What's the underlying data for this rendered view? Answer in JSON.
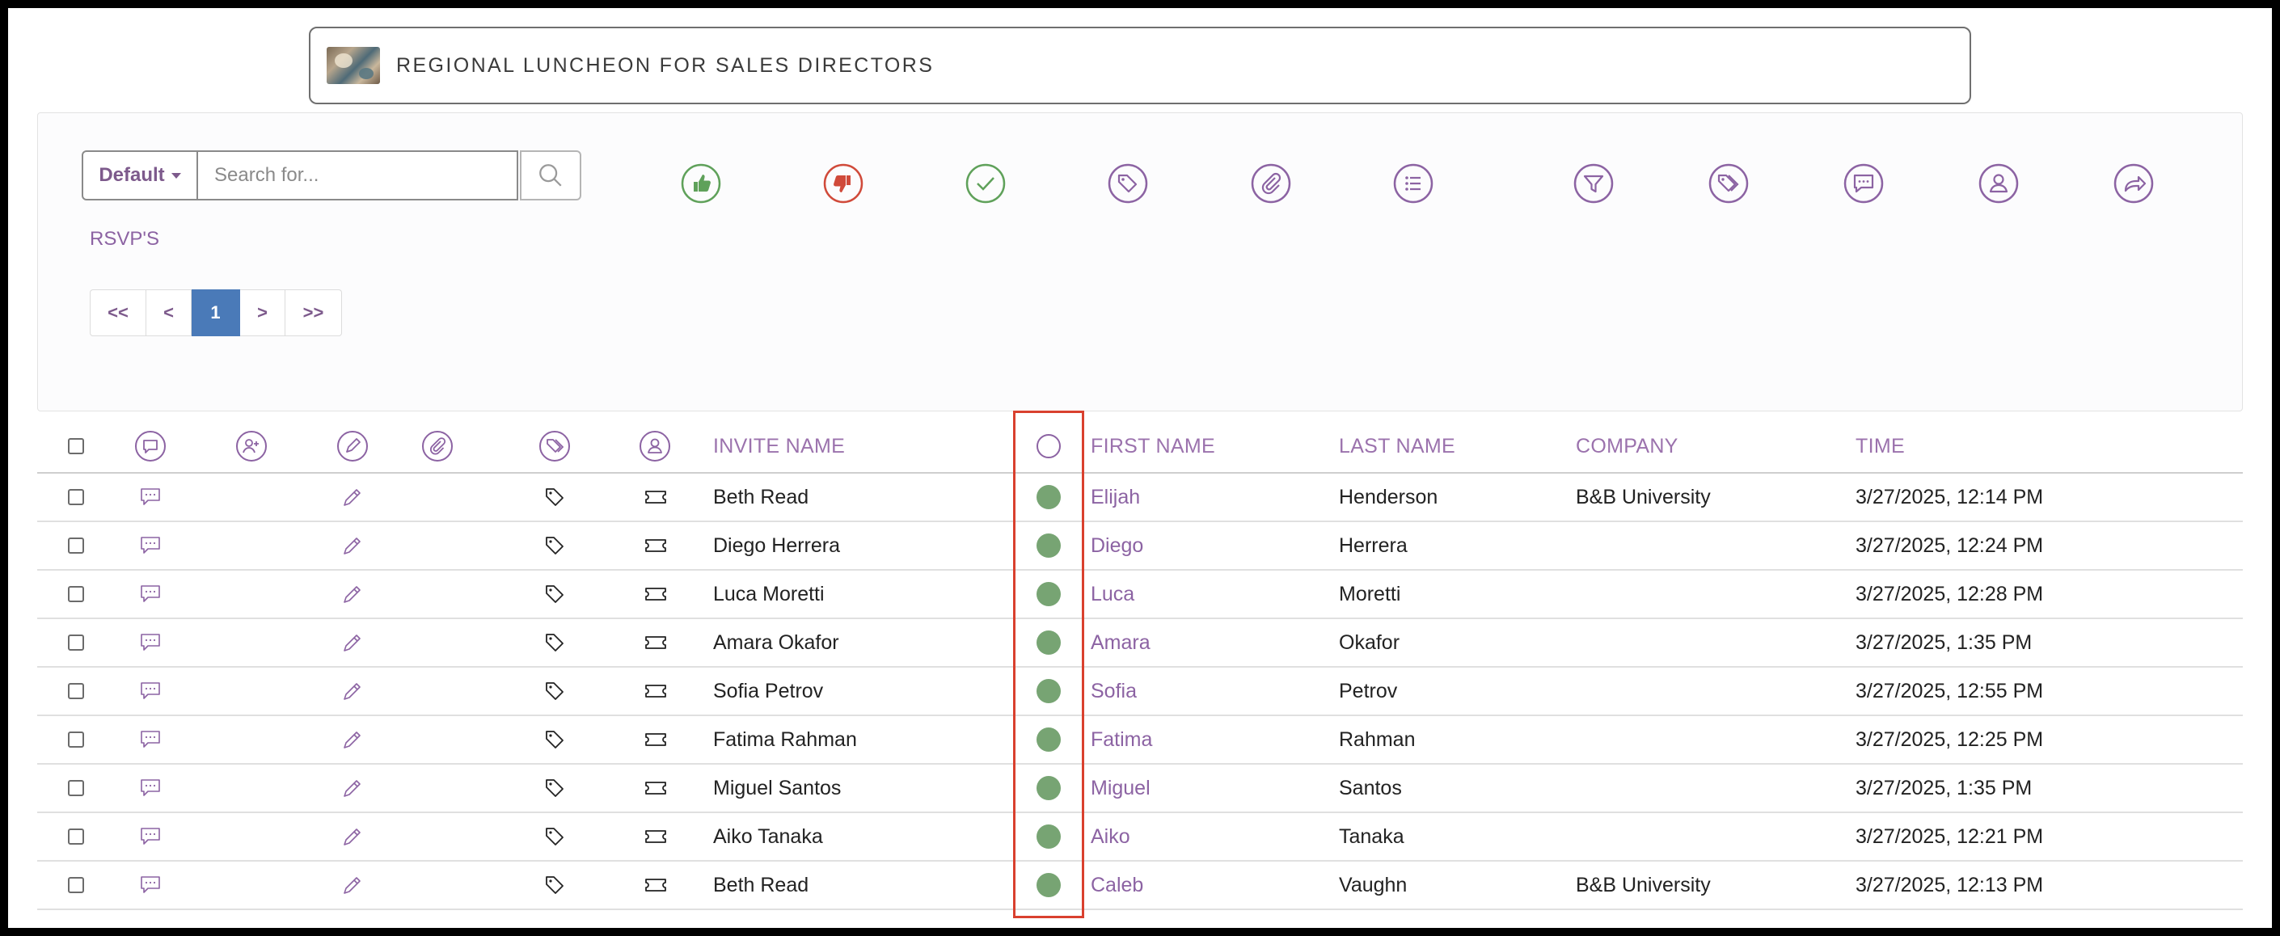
{
  "event": {
    "title": "REGIONAL LUNCHEON FOR SALES DIRECTORS"
  },
  "toolbar": {
    "dropdown_label": "Default",
    "search_placeholder": "Search for...",
    "rsvp_link": "RSVP'S",
    "icons": [
      "thumbs-up-icon",
      "thumbs-down-icon",
      "check-icon",
      "tag-icon",
      "paperclip-icon",
      "list-icon",
      "filter-icon",
      "tags-icon",
      "comment-icon",
      "user-icon",
      "share-icon"
    ]
  },
  "pagination": {
    "first": "<<",
    "prev": "<",
    "current": "1",
    "next": ">",
    "last": ">>"
  },
  "table": {
    "headers": {
      "invite_name": "INVITE NAME",
      "first_name": "FIRST NAME",
      "last_name": "LAST NAME",
      "company": "COMPANY",
      "time": "TIME"
    },
    "rows": [
      {
        "invite_name": "Beth Read",
        "first_name": "Elijah",
        "last_name": "Henderson",
        "company": "B&B University",
        "time": "3/27/2025, 12:14 PM"
      },
      {
        "invite_name": "Diego Herrera",
        "first_name": "Diego",
        "last_name": "Herrera",
        "company": "",
        "time": "3/27/2025, 12:24 PM"
      },
      {
        "invite_name": "Luca Moretti",
        "first_name": "Luca",
        "last_name": "Moretti",
        "company": "",
        "time": "3/27/2025, 12:28 PM"
      },
      {
        "invite_name": "Amara Okafor",
        "first_name": "Amara",
        "last_name": "Okafor",
        "company": "",
        "time": "3/27/2025, 1:35 PM"
      },
      {
        "invite_name": "Sofia Petrov",
        "first_name": "Sofia",
        "last_name": "Petrov",
        "company": "",
        "time": "3/27/2025, 12:55 PM"
      },
      {
        "invite_name": "Fatima Rahman",
        "first_name": "Fatima",
        "last_name": "Rahman",
        "company": "",
        "time": "3/27/2025, 12:25 PM"
      },
      {
        "invite_name": "Miguel Santos",
        "first_name": "Miguel",
        "last_name": "Santos",
        "company": "",
        "time": "3/27/2025, 1:35 PM"
      },
      {
        "invite_name": "Aiko Tanaka",
        "first_name": "Aiko",
        "last_name": "Tanaka",
        "company": "",
        "time": "3/27/2025, 12:21 PM"
      },
      {
        "invite_name": "Beth Read",
        "first_name": "Caleb",
        "last_name": "Vaughn",
        "company": "B&B University",
        "time": "3/27/2025, 12:13 PM"
      }
    ]
  },
  "colors": {
    "accent": "#8c63a3",
    "green": "#5fa15a",
    "red": "#d04a3a",
    "status_dot": "#77a473",
    "highlight": "#d9402e",
    "page_active": "#4a7ab8"
  }
}
